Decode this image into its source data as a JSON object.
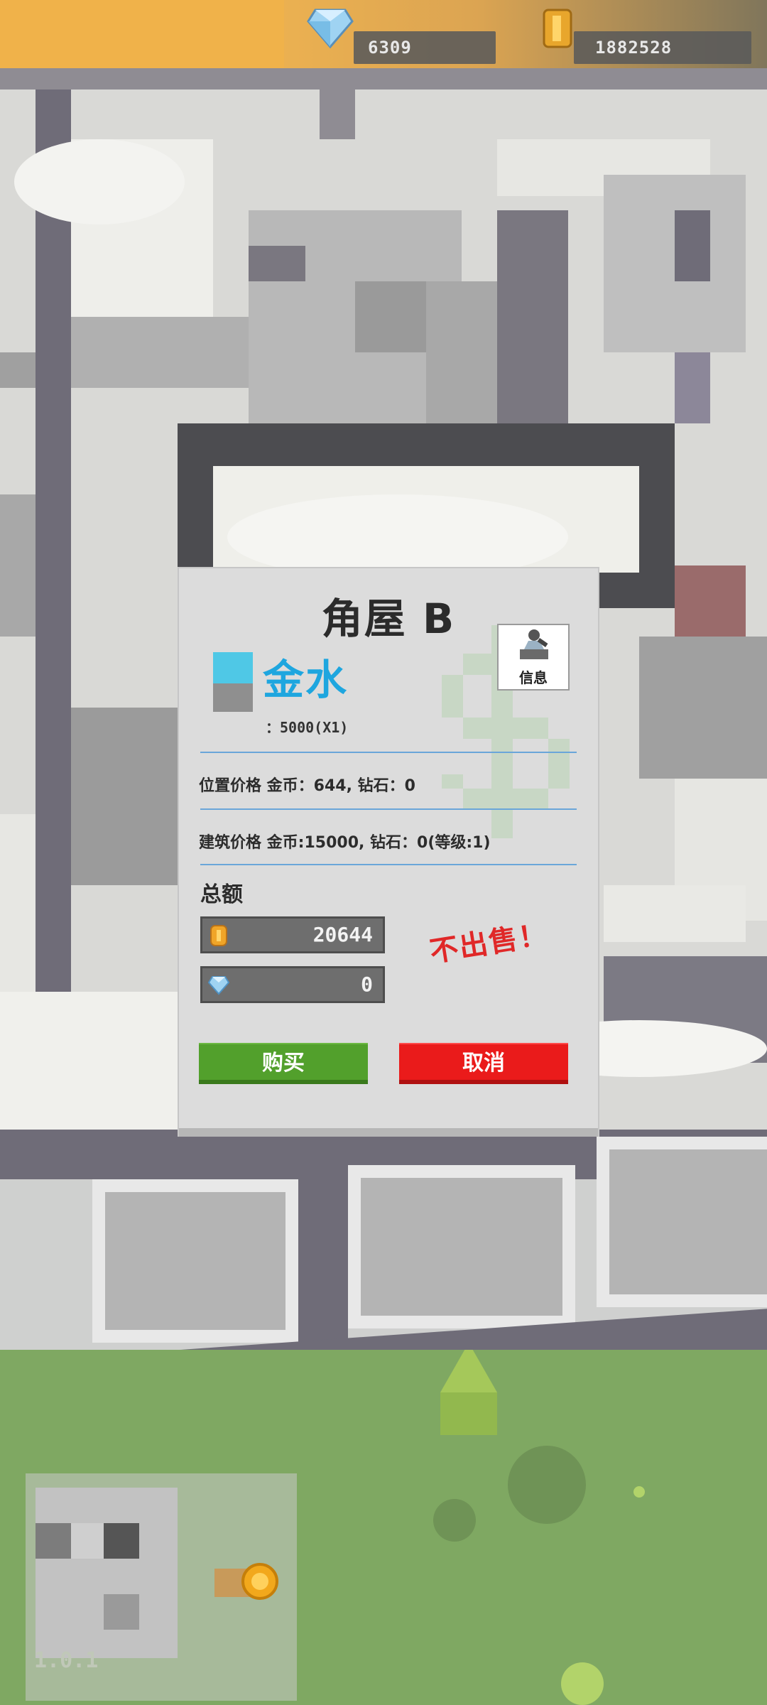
{
  "resources": {
    "diamonds": "6309",
    "coins": "1882528"
  },
  "modal": {
    "title": "角屋 B",
    "info_label": "信息",
    "building_name": "金水",
    "income_line": "：5000(X1)",
    "location_price": "位置价格 金币：644, 钻石：0",
    "building_price": "建筑价格 金币:15000, 钻石：0(等级:1)",
    "total_label": "总额",
    "total_coins": "20644",
    "total_diamonds": "0",
    "not_for_sale": "不出售！",
    "buy_label": "购买",
    "cancel_label": "取消"
  },
  "version": "1.0.1",
  "colors": {
    "accent_blue": "#1ea6df",
    "buy_green": "#52a02c",
    "cancel_red": "#ea1b1b",
    "warning_red": "#e02828",
    "top_bar": "#f0b24a"
  },
  "icons": {
    "diamond": "diamond-icon",
    "coin": "coin-icon",
    "info": "magnifier-icon",
    "dollar": "dollar-sign-icon"
  }
}
